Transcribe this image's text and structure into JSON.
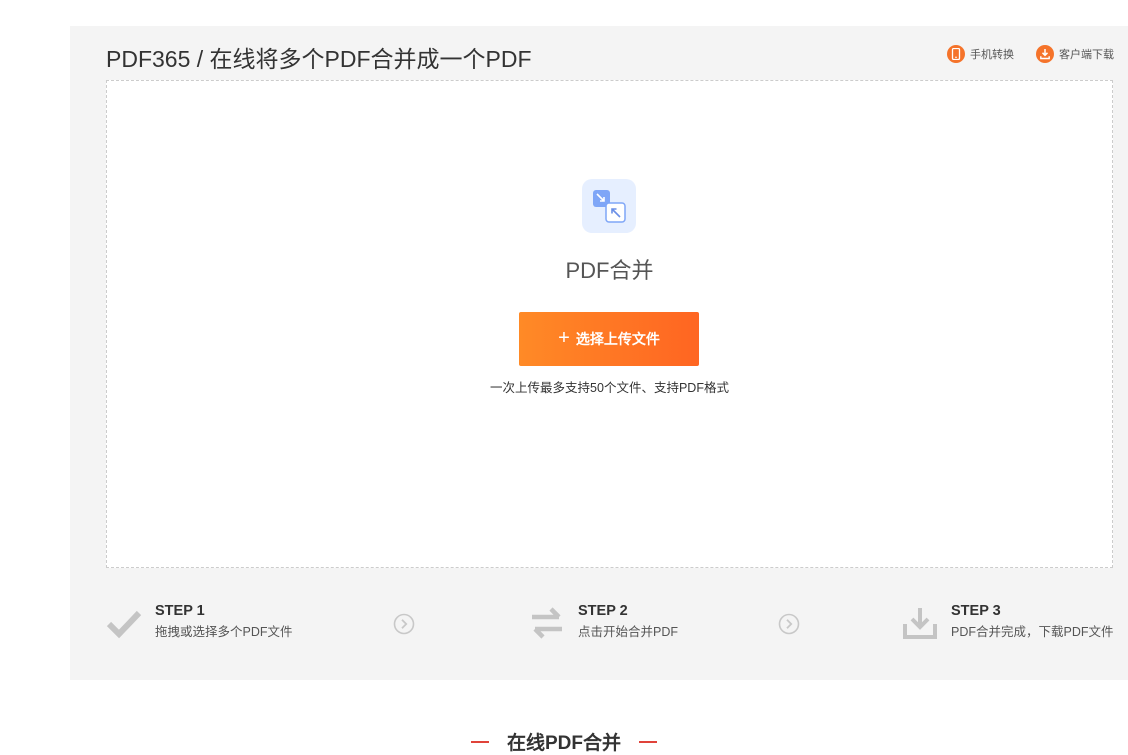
{
  "header": {
    "title": "PDF365 / 在线将多个PDF合并成一个PDF",
    "links": [
      {
        "label": "手机转换",
        "icon": "mobile-icon"
      },
      {
        "label": "客户端下载",
        "icon": "download-icon"
      }
    ]
  },
  "dropzone": {
    "tool_icon": "merge-icon",
    "tool_name": "PDF合并",
    "upload_button": {
      "plus": "+",
      "label": "选择上传文件"
    },
    "hint": "一次上传最多支持50个文件、支持PDF格式"
  },
  "steps": [
    {
      "label": "STEP 1",
      "desc": "拖拽或选择多个PDF文件",
      "icon": "check-icon"
    },
    {
      "label": "STEP 2",
      "desc": "点击开始合并PDF",
      "icon": "swap-arrows-icon"
    },
    {
      "label": "STEP 3",
      "desc": "PDF合并完成，下载PDF文件",
      "icon": "download-tray-icon"
    }
  ],
  "section": {
    "title": "在线PDF合并"
  },
  "colors": {
    "accent": "#ff6d24",
    "panel_bg": "#f4f4f4",
    "icon_bg": "#e6efff",
    "section_dash": "#e0433a"
  }
}
